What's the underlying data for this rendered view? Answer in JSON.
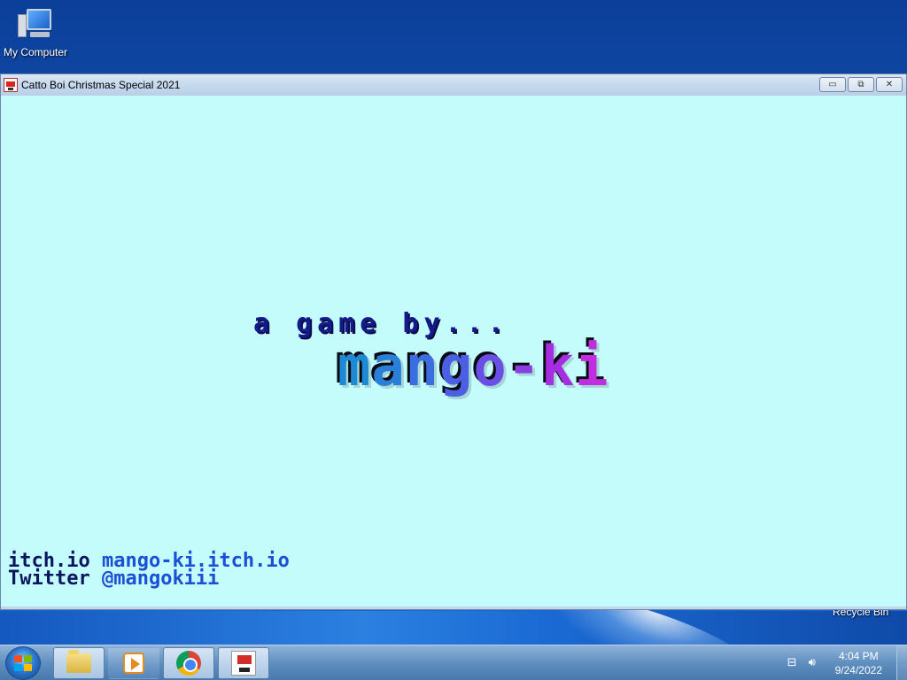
{
  "desktop": {
    "icons": [
      {
        "label": "My Computer",
        "icon": "computer-icon"
      },
      {
        "label": "Recycle Bin",
        "icon": "recycle-bin-icon"
      }
    ]
  },
  "window": {
    "title": "Catto Boi Christmas Special 2021",
    "controls": {
      "minimize": "▭",
      "restore": "⧉",
      "close": "✕"
    }
  },
  "game": {
    "subtitle": "a game by...",
    "logo": {
      "letters": [
        "m",
        "a",
        "n",
        "g",
        "o",
        "-",
        "k",
        "i"
      ],
      "colors": [
        "#1e8ad6",
        "#2a7fd8",
        "#3a6ee0",
        "#4a5fe3",
        "#6a4fe6",
        "#8a3fe0",
        "#a62ee2",
        "#c12ee0"
      ]
    },
    "credits": [
      {
        "label": "itch.io ",
        "value": "mango-ki.itch.io"
      },
      {
        "label": "Twitter ",
        "value": "@mangokiii"
      }
    ]
  },
  "taskbar": {
    "start": "start-button",
    "pinned": [
      {
        "name": "windows-explorer",
        "icon": "folder-icon"
      },
      {
        "name": "media-player",
        "icon": "media-player-icon"
      },
      {
        "name": "chrome",
        "icon": "chrome-icon"
      },
      {
        "name": "catto-boi-game",
        "icon": "game-icon"
      }
    ],
    "tray": {
      "network_icon": "network-icon",
      "volume_icon": "volume-icon",
      "time": "4:04 PM",
      "date": "9/24/2022"
    }
  }
}
